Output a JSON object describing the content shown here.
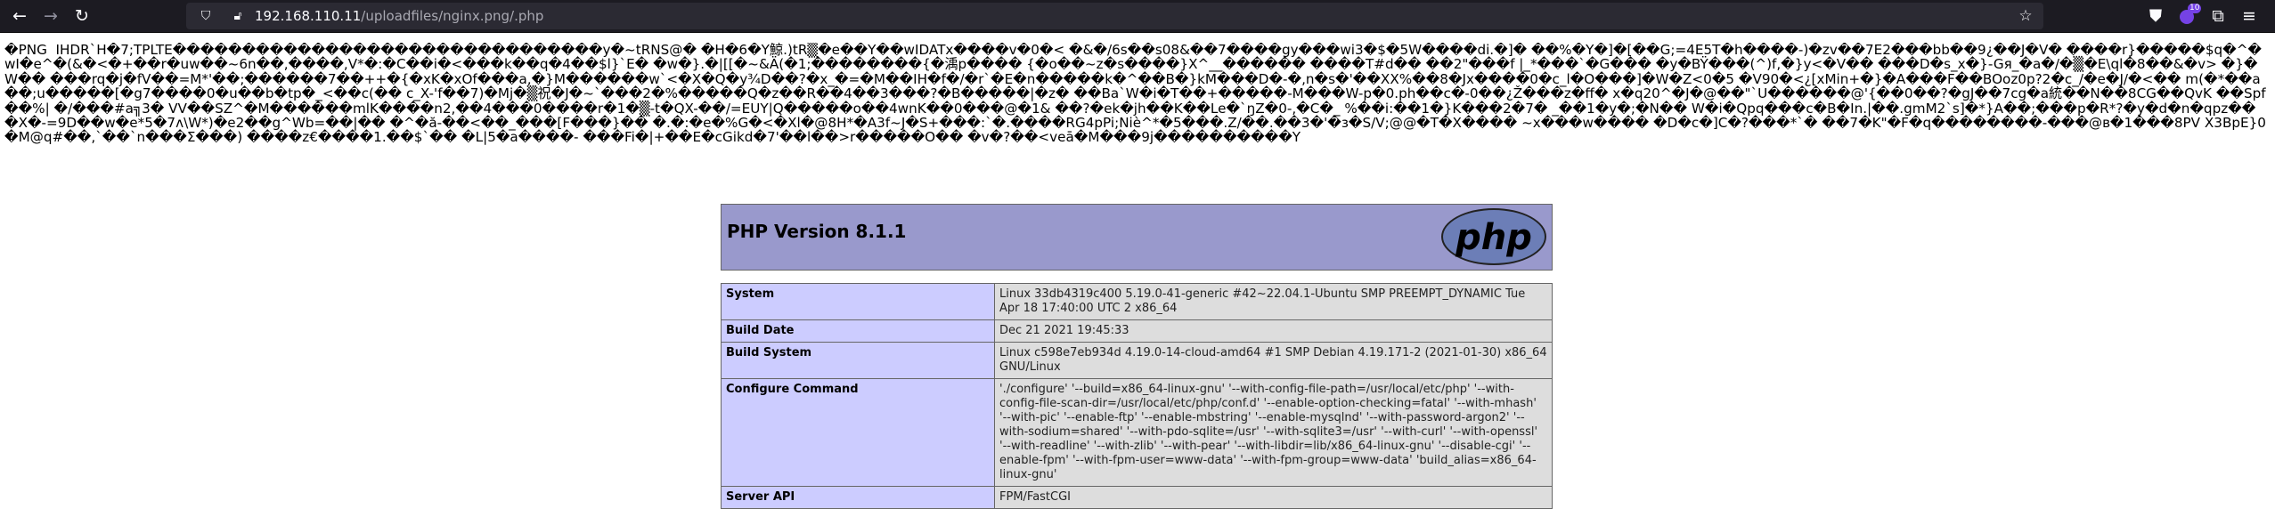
{
  "browser": {
    "url_host": "192.168.110.11",
    "url_path": "/uploadfiles/nginx.png/.php",
    "extension_badge": "10"
  },
  "garbage_text": "�PNG  IHDR`H�7;TPLTE�������������������������������y�~tRNS@� �H�6�Y鯨.)tR▒�e��Y��wIDATx����v�0�< �&�/6s��s08&��7����gy���wi3�$�5W����di.�]� ��%�Y�]�[��G;=4E5T�h����-)�zv��7E2���bb��9¿��J�V� ����r}�����$q�^�wI�e^�(&�<�+��r�uw��~6n��,����,V*�:�C��i�<���k��q�4��$l}`E� �w�}.�|[[�~&Ä(�1;��������{�渪p���� {�o��~z�s����}X^__������ ����T#d�� ��2\"���f |_*���`�G��� �y�BŸ���(^)f,�}y<�V�� ���D�s_x�}-Gя_�a�/�▒�E\\ql�8��&�v> �}�W�� ���rq�j�fV��=M*'��;������7��++�{�xK�xOf���a,�}M������w`<�X�Q�y¾D��?�x_�=�M��IH�f�/�r`�E�n�����k�^��B�}kM���D�-�,n�s�'��XX%��8�Jx����0�c_l�O���]�W�Z<0�5 �V90�<¿[xMin+�}�A���F��BOoz0p?2�c_/�e�J/�<�� m(�*��a��;u�����[�g7����0�u��b�tp�_<��c(�� c_X-'f��7)�Mj�▒祝�J�~`���2�%�����Q�z��R��4��3���?�B�����|�z� ��Ba`W�i�T��+�����-M���W-p�0.ph��c�-0��¿Ž���z�ff� x�q20^�J�@��\"`U������@'{��0��?�gJ��7cg�a統��N��8CG��QvK ��Spf��%| �/���#a╗3� VV��SZ^�M������mlK����n2,��4���0����r�1�▒-t�QX-��/=EUY|Q�����o��4wnK��0���@�1& ��?�ek�jh��K��Le�`ŋZ�0-,�C�_ %��i:��1�}K���2�7� _��1�y�;�N�� W�i�Qpq���c�B�In.|��.gmM2`s]�*}A��;���p�R*?�y�d�n�qpz���X�-=9D��w�e*5�7ᴧ\\W*)�e2��g^Wb=��|�� �^�ă-��<��_���[F���}�� �.�:�e�%G�<�Xl�@8H*�A3f~J�S+���:`�.����RG4pPi;Niè^*�5���.Z/��.��3�'�з�S/V;@@�T�X���� ~x���w���� �D�c�]C�?���*`� ��7�K\"�F�q��������-���@ʙ�1���8PV X3BpE}0�M@q#��,`��`n���Σ���) ����z€����1.��$`�� �L|5�a����- ���Fi�|+��E�cGikd�7'��l��>r�����O�� �v�?��<veā�M���9j����������Y",
  "phpinfo": {
    "title": "PHP Version 8.1.1",
    "logo_text": "php",
    "rows": [
      {
        "key": "System",
        "value": "Linux 33db4319c400 5.19.0-41-generic #42~22.04.1-Ubuntu SMP PREEMPT_DYNAMIC Tue Apr 18 17:40:00 UTC 2 x86_64"
      },
      {
        "key": "Build Date",
        "value": "Dec 21 2021 19:45:33"
      },
      {
        "key": "Build System",
        "value": "Linux c598e7eb934d 4.19.0-14-cloud-amd64 #1 SMP Debian 4.19.171-2 (2021-01-30) x86_64 GNU/Linux"
      },
      {
        "key": "Configure Command",
        "value": "'./configure' '--build=x86_64-linux-gnu' '--with-config-file-path=/usr/local/etc/php' '--with-config-file-scan-dir=/usr/local/etc/php/conf.d' '--enable-option-checking=fatal' '--with-mhash' '--with-pic' '--enable-ftp' '--enable-mbstring' '--enable-mysqlnd' '--with-password-argon2' '--with-sodium=shared' '--with-pdo-sqlite=/usr' '--with-sqlite3=/usr' '--with-curl' '--with-openssl' '--with-readline' '--with-zlib' '--with-pear' '--with-libdir=lib/x86_64-linux-gnu' '--disable-cgi' '--enable-fpm' '--with-fpm-user=www-data' '--with-fpm-group=www-data' 'build_alias=x86_64-linux-gnu'"
      },
      {
        "key": "Server API",
        "value": "FPM/FastCGI"
      }
    ]
  }
}
